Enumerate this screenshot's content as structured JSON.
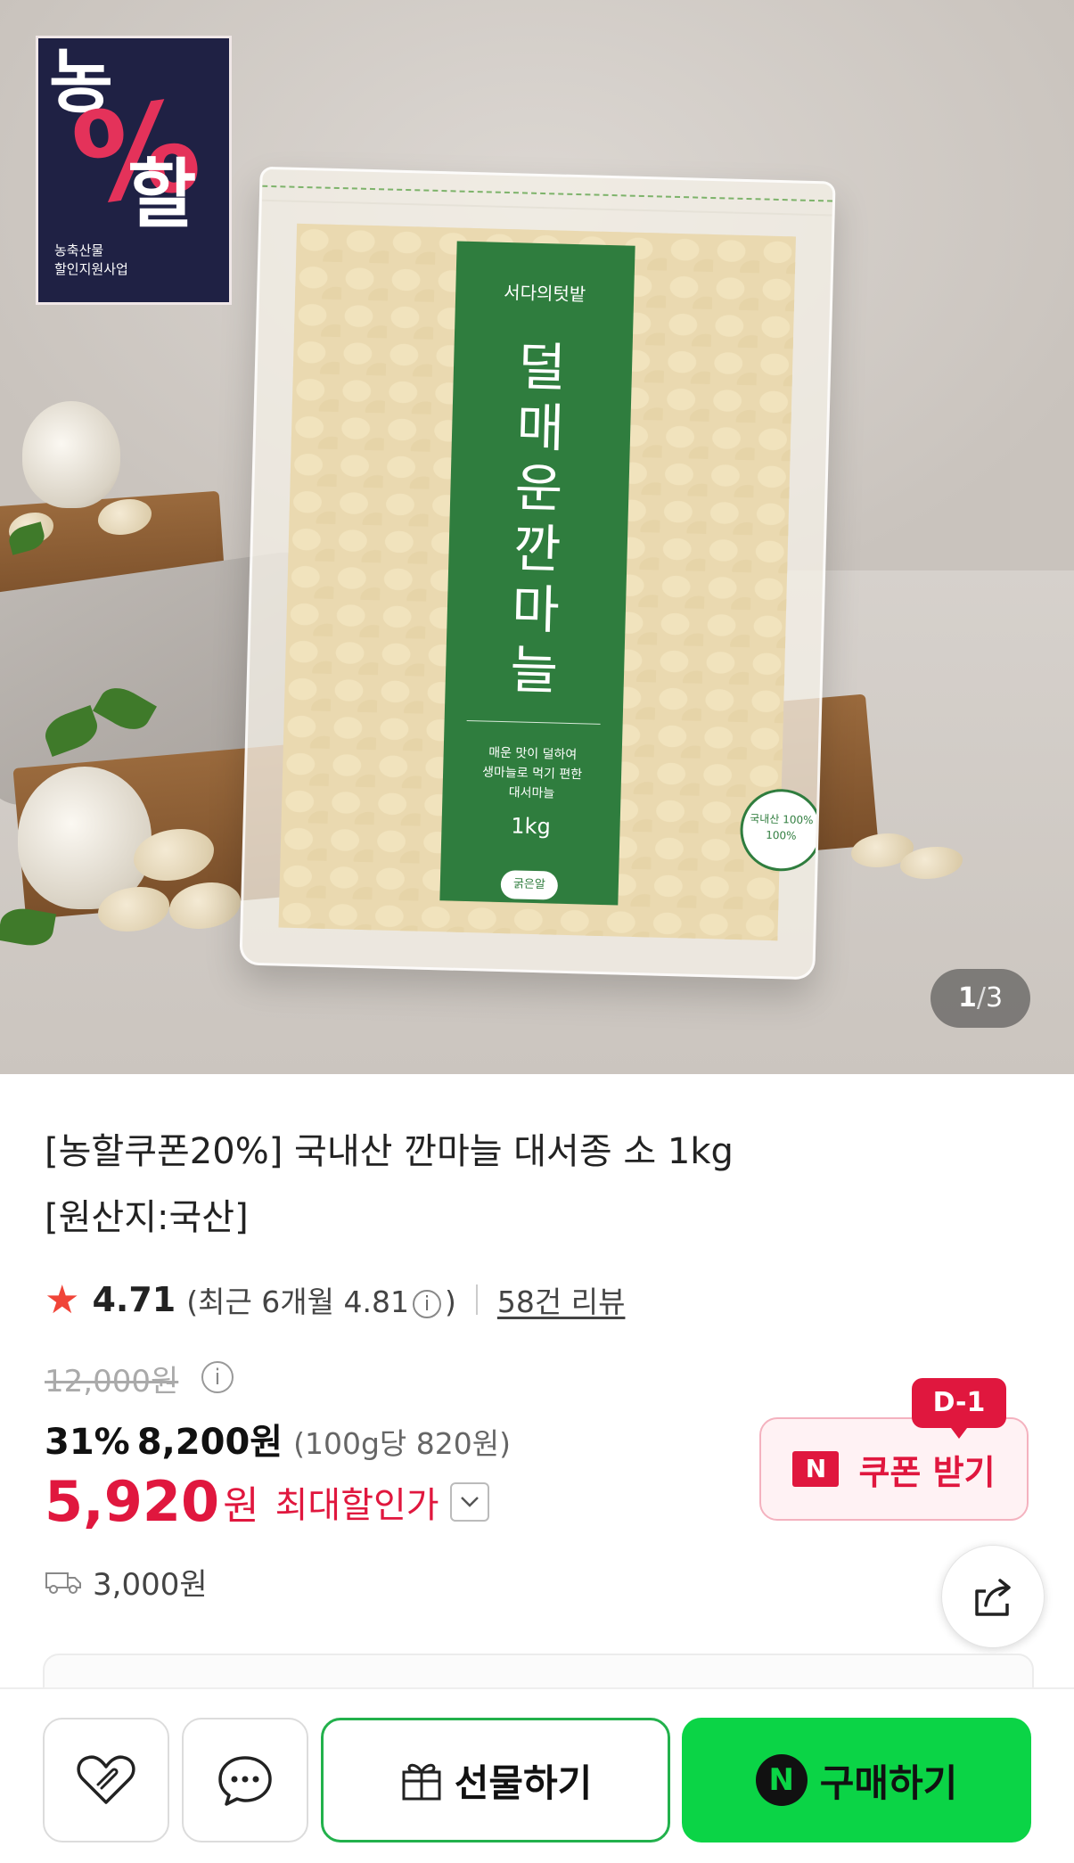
{
  "hero": {
    "logo": {
      "line1": "농",
      "percent": "%",
      "line2": "할",
      "caption1": "농축산물",
      "caption2": "할인지원사업"
    },
    "package": {
      "brand": "서다의텃밭",
      "name": "덜매운 깐마늘",
      "desc1": "매운 맛이 덜하여",
      "desc2": "생마늘로 먹기 편한",
      "desc3": "대서마늘",
      "weight": "1kg",
      "size_badge": "굵은알",
      "seal1": "국내산 100%",
      "seal2": "100%"
    },
    "counter": {
      "current": "1",
      "separator": "/",
      "total": "3"
    }
  },
  "product": {
    "title_line1": "[농할쿠폰20%] 국내산 깐마늘 대서종 소 1kg",
    "title_line2": "[원산지:국산]",
    "rating": "4.71",
    "recent_prefix": "(최근 6개월 4.81",
    "recent_suffix": ")",
    "info_glyph": "i",
    "reviews": "58건 리뷰",
    "original_price": "12,000원",
    "discount_pct": "31%",
    "discount_price": "8,200원",
    "unit_price": "(100g당 820원)",
    "final_price": "5,920",
    "final_won": "원",
    "final_label": "최대할인가",
    "coupon_badge": "D-1",
    "coupon_n": "N",
    "coupon_label": "쿠폰 받기",
    "shipping": "3,000원"
  },
  "bottom_bar": {
    "gift_label": "선물하기",
    "buy_n": "N",
    "buy_label": "구매하기"
  },
  "colors": {
    "accent_red": "#e0173e",
    "naver_green": "#0bd446",
    "label_green": "#2f7d3e",
    "logo_navy": "#1f2144"
  },
  "icons": [
    "star-icon",
    "info-icon",
    "chevron-down-icon",
    "truck-icon",
    "share-icon",
    "heart-clip-icon",
    "chat-bubble-icon",
    "gift-icon"
  ]
}
